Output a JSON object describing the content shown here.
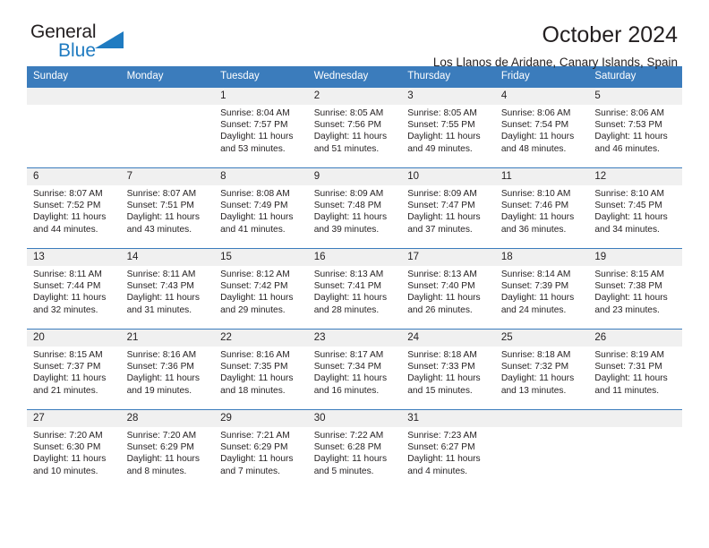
{
  "logo": {
    "word_one": "General",
    "word_two": "Blue",
    "triangle_icon": "triangle-icon",
    "brand_blue": "#1f7bc1"
  },
  "header": {
    "title": "October 2024",
    "subtitle": "Los Llanos de Aridane, Canary Islands, Spain"
  },
  "calendar": {
    "header_bg": "#3b7cbc",
    "daynum_bg": "#f0f0f0",
    "weekdays": [
      "Sunday",
      "Monday",
      "Tuesday",
      "Wednesday",
      "Thursday",
      "Friday",
      "Saturday"
    ],
    "labels": {
      "sunrise": "Sunrise:",
      "sunset": "Sunset:",
      "daylight": "Daylight:"
    },
    "weeks": [
      [
        {
          "day": "",
          "empty": true
        },
        {
          "day": "",
          "empty": true
        },
        {
          "day": "1",
          "sunrise": "Sunrise: 8:04 AM",
          "sunset": "Sunset: 7:57 PM",
          "daylight": "Daylight: 11 hours and 53 minutes."
        },
        {
          "day": "2",
          "sunrise": "Sunrise: 8:05 AM",
          "sunset": "Sunset: 7:56 PM",
          "daylight": "Daylight: 11 hours and 51 minutes."
        },
        {
          "day": "3",
          "sunrise": "Sunrise: 8:05 AM",
          "sunset": "Sunset: 7:55 PM",
          "daylight": "Daylight: 11 hours and 49 minutes."
        },
        {
          "day": "4",
          "sunrise": "Sunrise: 8:06 AM",
          "sunset": "Sunset: 7:54 PM",
          "daylight": "Daylight: 11 hours and 48 minutes."
        },
        {
          "day": "5",
          "sunrise": "Sunrise: 8:06 AM",
          "sunset": "Sunset: 7:53 PM",
          "daylight": "Daylight: 11 hours and 46 minutes."
        }
      ],
      [
        {
          "day": "6",
          "sunrise": "Sunrise: 8:07 AM",
          "sunset": "Sunset: 7:52 PM",
          "daylight": "Daylight: 11 hours and 44 minutes."
        },
        {
          "day": "7",
          "sunrise": "Sunrise: 8:07 AM",
          "sunset": "Sunset: 7:51 PM",
          "daylight": "Daylight: 11 hours and 43 minutes."
        },
        {
          "day": "8",
          "sunrise": "Sunrise: 8:08 AM",
          "sunset": "Sunset: 7:49 PM",
          "daylight": "Daylight: 11 hours and 41 minutes."
        },
        {
          "day": "9",
          "sunrise": "Sunrise: 8:09 AM",
          "sunset": "Sunset: 7:48 PM",
          "daylight": "Daylight: 11 hours and 39 minutes."
        },
        {
          "day": "10",
          "sunrise": "Sunrise: 8:09 AM",
          "sunset": "Sunset: 7:47 PM",
          "daylight": "Daylight: 11 hours and 37 minutes."
        },
        {
          "day": "11",
          "sunrise": "Sunrise: 8:10 AM",
          "sunset": "Sunset: 7:46 PM",
          "daylight": "Daylight: 11 hours and 36 minutes."
        },
        {
          "day": "12",
          "sunrise": "Sunrise: 8:10 AM",
          "sunset": "Sunset: 7:45 PM",
          "daylight": "Daylight: 11 hours and 34 minutes."
        }
      ],
      [
        {
          "day": "13",
          "sunrise": "Sunrise: 8:11 AM",
          "sunset": "Sunset: 7:44 PM",
          "daylight": "Daylight: 11 hours and 32 minutes."
        },
        {
          "day": "14",
          "sunrise": "Sunrise: 8:11 AM",
          "sunset": "Sunset: 7:43 PM",
          "daylight": "Daylight: 11 hours and 31 minutes."
        },
        {
          "day": "15",
          "sunrise": "Sunrise: 8:12 AM",
          "sunset": "Sunset: 7:42 PM",
          "daylight": "Daylight: 11 hours and 29 minutes."
        },
        {
          "day": "16",
          "sunrise": "Sunrise: 8:13 AM",
          "sunset": "Sunset: 7:41 PM",
          "daylight": "Daylight: 11 hours and 28 minutes."
        },
        {
          "day": "17",
          "sunrise": "Sunrise: 8:13 AM",
          "sunset": "Sunset: 7:40 PM",
          "daylight": "Daylight: 11 hours and 26 minutes."
        },
        {
          "day": "18",
          "sunrise": "Sunrise: 8:14 AM",
          "sunset": "Sunset: 7:39 PM",
          "daylight": "Daylight: 11 hours and 24 minutes."
        },
        {
          "day": "19",
          "sunrise": "Sunrise: 8:15 AM",
          "sunset": "Sunset: 7:38 PM",
          "daylight": "Daylight: 11 hours and 23 minutes."
        }
      ],
      [
        {
          "day": "20",
          "sunrise": "Sunrise: 8:15 AM",
          "sunset": "Sunset: 7:37 PM",
          "daylight": "Daylight: 11 hours and 21 minutes."
        },
        {
          "day": "21",
          "sunrise": "Sunrise: 8:16 AM",
          "sunset": "Sunset: 7:36 PM",
          "daylight": "Daylight: 11 hours and 19 minutes."
        },
        {
          "day": "22",
          "sunrise": "Sunrise: 8:16 AM",
          "sunset": "Sunset: 7:35 PM",
          "daylight": "Daylight: 11 hours and 18 minutes."
        },
        {
          "day": "23",
          "sunrise": "Sunrise: 8:17 AM",
          "sunset": "Sunset: 7:34 PM",
          "daylight": "Daylight: 11 hours and 16 minutes."
        },
        {
          "day": "24",
          "sunrise": "Sunrise: 8:18 AM",
          "sunset": "Sunset: 7:33 PM",
          "daylight": "Daylight: 11 hours and 15 minutes."
        },
        {
          "day": "25",
          "sunrise": "Sunrise: 8:18 AM",
          "sunset": "Sunset: 7:32 PM",
          "daylight": "Daylight: 11 hours and 13 minutes."
        },
        {
          "day": "26",
          "sunrise": "Sunrise: 8:19 AM",
          "sunset": "Sunset: 7:31 PM",
          "daylight": "Daylight: 11 hours and 11 minutes."
        }
      ],
      [
        {
          "day": "27",
          "sunrise": "Sunrise: 7:20 AM",
          "sunset": "Sunset: 6:30 PM",
          "daylight": "Daylight: 11 hours and 10 minutes."
        },
        {
          "day": "28",
          "sunrise": "Sunrise: 7:20 AM",
          "sunset": "Sunset: 6:29 PM",
          "daylight": "Daylight: 11 hours and 8 minutes."
        },
        {
          "day": "29",
          "sunrise": "Sunrise: 7:21 AM",
          "sunset": "Sunset: 6:29 PM",
          "daylight": "Daylight: 11 hours and 7 minutes."
        },
        {
          "day": "30",
          "sunrise": "Sunrise: 7:22 AM",
          "sunset": "Sunset: 6:28 PM",
          "daylight": "Daylight: 11 hours and 5 minutes."
        },
        {
          "day": "31",
          "sunrise": "Sunrise: 7:23 AM",
          "sunset": "Sunset: 6:27 PM",
          "daylight": "Daylight: 11 hours and 4 minutes."
        },
        {
          "day": "",
          "empty": true
        },
        {
          "day": "",
          "empty": true
        }
      ]
    ]
  }
}
